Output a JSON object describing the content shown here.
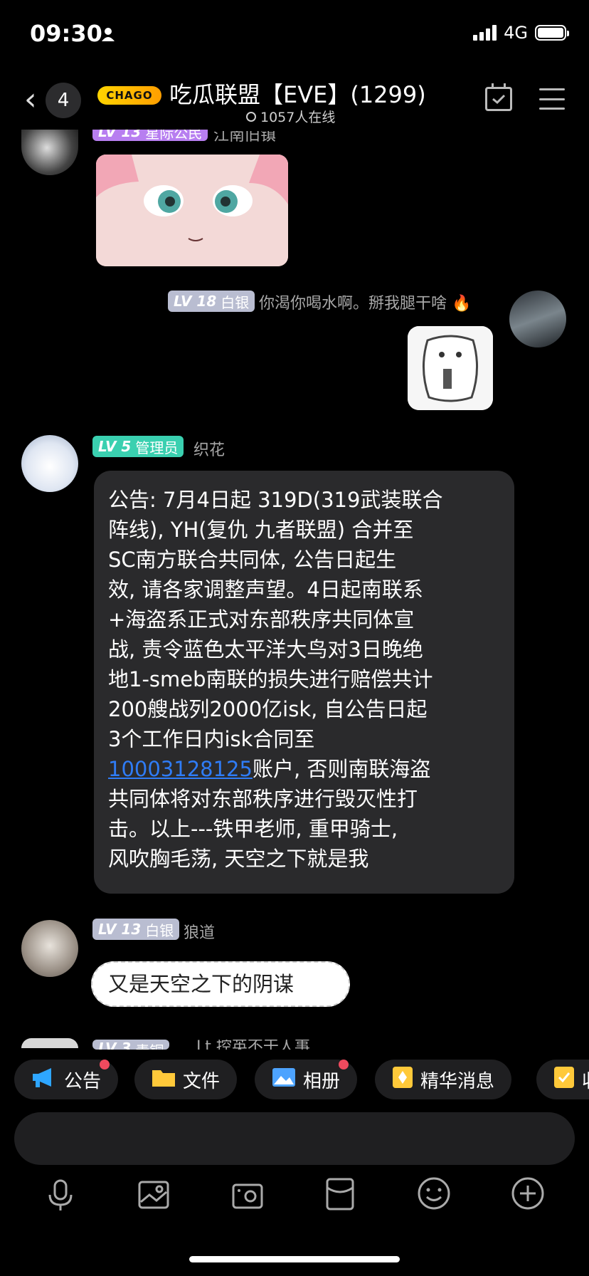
{
  "status_bar": {
    "time": "09:30",
    "network": "4G"
  },
  "header": {
    "unread_count": "4",
    "group_logo": "CHAGO",
    "group_title": "吃瓜联盟【EVE】(1299)",
    "online_text": "1057人在线"
  },
  "messages": [
    {
      "badge_level": "LV 13",
      "badge_title": "星际公民",
      "nickname": "江南旧镇",
      "content": "sticker"
    },
    {
      "badge_level": "LV 18",
      "badge_title": "白银",
      "nickname": "你渴你喝水啊。掰我腿干啥 🔥",
      "content": "sticker"
    },
    {
      "badge_level": "LV 5",
      "badge_title": "管理员",
      "nickname": "织花",
      "lines": [
        "公告: 7月4日起 319D(319武装联合",
        "阵线), YH(复仇 九者联盟) 合并至",
        "SC南方联合共同体, 公告日起生",
        "效, 请各家调整声望。4日起南联系",
        "+海盗系正式对东部秩序共同体宣",
        "战, 责令蓝色太平洋大鸟对3日晚绝",
        "地1-smeb南联的损失进行赔偿共计",
        "200艘战列2000亿isk, 自公告日起",
        "3个工作日内isk合同至"
      ],
      "link_text": "10003128125",
      "link_suffix": "账户, 否则南联海盗",
      "lines_after": [
        "共同体将对东部秩序进行毁灭性打",
        "击。以上---铁甲老师, 重甲骑士,",
        "风吹胸毛荡, 天空之下就是我"
      ]
    },
    {
      "badge_level": "LV 13",
      "badge_title": "白银",
      "nickname": "狼道",
      "text": "又是天空之下的阴谋"
    },
    {
      "badge_level": "LV 3",
      "badge_title": "青铜",
      "nickname": "Lt 控英不干人事"
    }
  ],
  "toolbar": [
    {
      "label": "公告",
      "icon": "megaphone-icon",
      "dot": true
    },
    {
      "label": "文件",
      "icon": "folder-icon",
      "dot": false
    },
    {
      "label": "相册",
      "icon": "album-icon",
      "dot": true
    },
    {
      "label": "精华消息",
      "icon": "essence-icon",
      "dot": false
    },
    {
      "label": "收",
      "icon": "note-icon",
      "dot": false
    }
  ],
  "colors": {
    "admin_badge": "#3ad0b0",
    "silver_badge": "#b9bdd1",
    "citizen_badge": "#b77ef0",
    "link": "#2f7cf6"
  }
}
